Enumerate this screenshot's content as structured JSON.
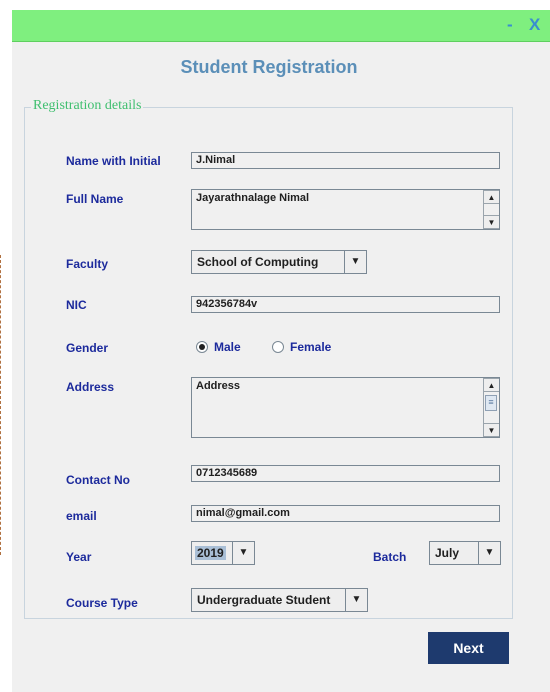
{
  "window": {
    "title": "Student Registration",
    "minimize_label": "-",
    "close_label": "X"
  },
  "panel": {
    "legend": "Registration details"
  },
  "fields": {
    "name_initial": {
      "label": "Name with Initial",
      "value": "J.Nimal"
    },
    "full_name": {
      "label": "Full Name",
      "value": "Jayarathnalage Nimal"
    },
    "faculty": {
      "label": "Faculty",
      "value": "School of Computing"
    },
    "nic": {
      "label": "NIC",
      "value": "942356784v"
    },
    "gender": {
      "label": "Gender",
      "options": [
        "Male",
        "Female"
      ],
      "selected": "Male"
    },
    "address": {
      "label": "Address",
      "value": "Address"
    },
    "contact": {
      "label": "Contact No",
      "value": "0712345689"
    },
    "email": {
      "label": "email",
      "value": "nimal@gmail.com"
    },
    "year": {
      "label": "Year",
      "value": "2019"
    },
    "batch": {
      "label": "Batch",
      "value": "July"
    },
    "course_type": {
      "label": "Course Type",
      "value": "Undergraduate Student"
    }
  },
  "icons": {
    "dropdown": "▼",
    "scroll_up": "▲",
    "scroll_down": "▼",
    "scroll_grip": "≡"
  },
  "colors": {
    "titlebar": "#7fef7f",
    "label": "#1c2a9c",
    "title": "#5b8fb8",
    "legend": "#3fbf6f",
    "next_button": "#1e3a6e"
  },
  "actions": {
    "next_label": "Next"
  }
}
